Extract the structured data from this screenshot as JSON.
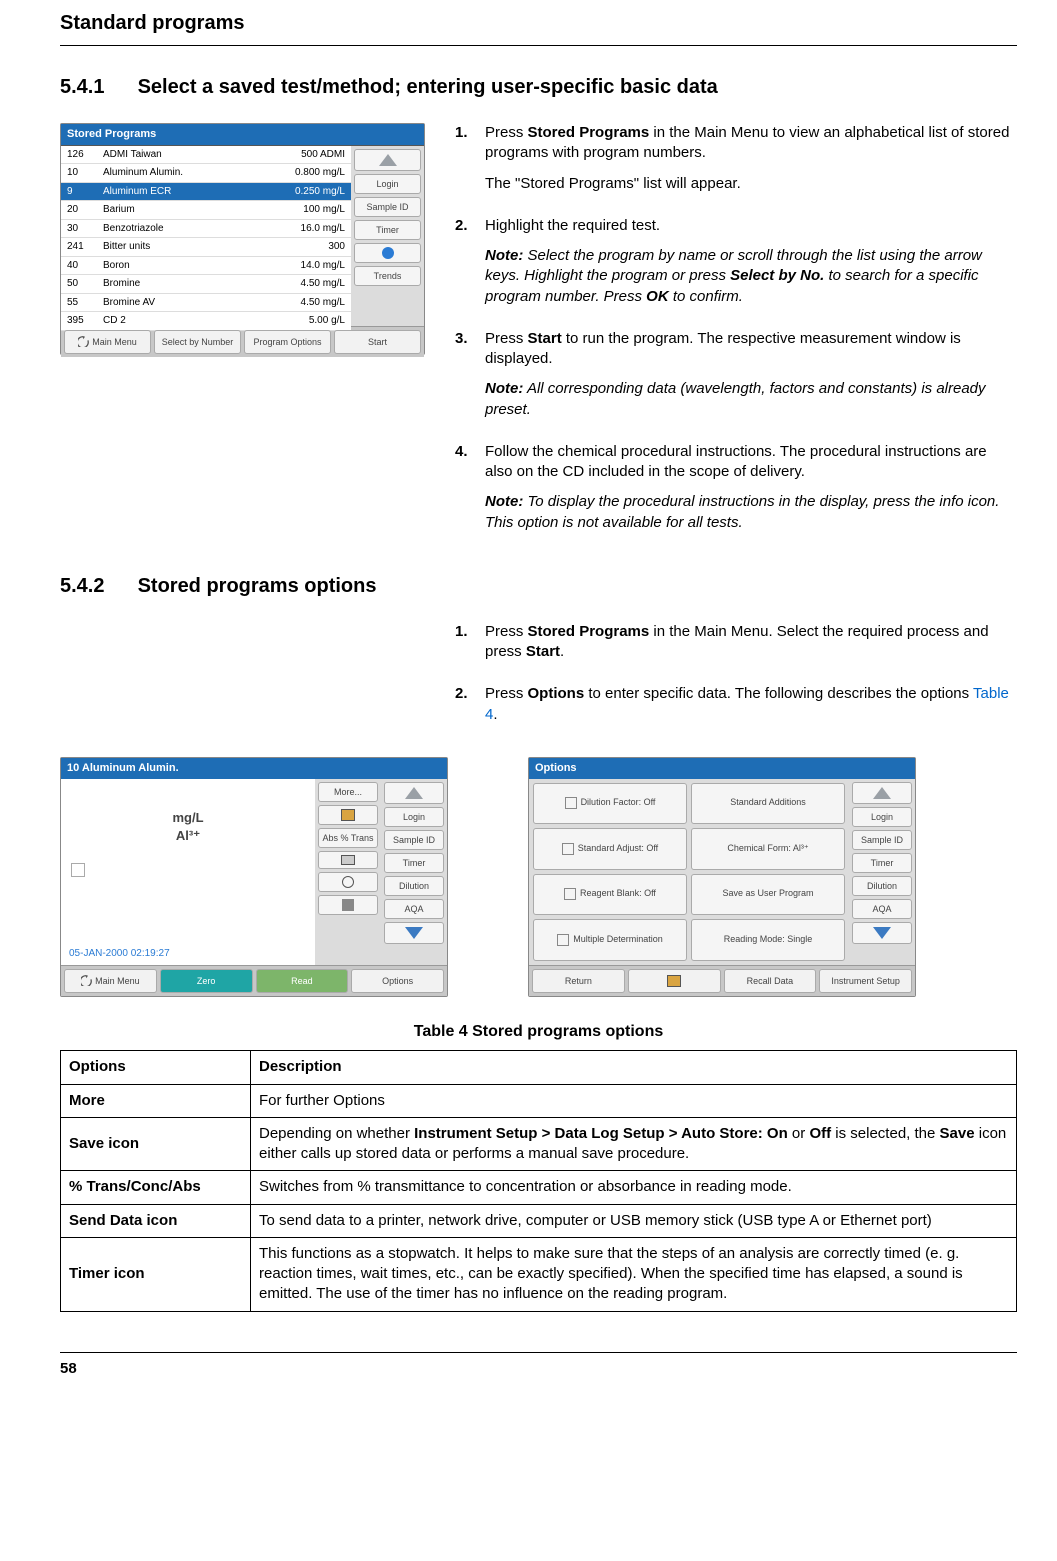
{
  "header": {
    "running": "Standard programs"
  },
  "section_541": {
    "number": "5.4.1",
    "title": "Select a saved test/method; entering user-specific basic data",
    "steps": [
      {
        "num": "1.",
        "paras": [
          "Press <b>Stored Programs</b> in the Main Menu to view an alphabetical list of stored programs with program numbers.",
          "The \"Stored Programs\" list will appear."
        ]
      },
      {
        "num": "2.",
        "paras": [
          "Highlight the required test."
        ],
        "note": "<b>Note:</b> Select the program by name or scroll through the list using the arrow keys. Highlight the program or press <b>Select by No.</b> to search for a specific program number. Press <b>OK</b> to confirm."
      },
      {
        "num": "3.",
        "paras": [
          "Press <b>Start</b> to run the program. The respective measurement window is displayed."
        ],
        "note": "<b>Note:</b> All corresponding data (wavelength, factors and constants) is already preset."
      },
      {
        "num": "4.",
        "paras": [
          "Follow the chemical procedural instructions. The procedural instructions are also on the CD included in the scope of delivery."
        ],
        "note": "<b>Note:</b> To display the procedural instructions in the display, press the info icon. This option is not available for all tests."
      }
    ]
  },
  "section_542": {
    "number": "5.4.2",
    "title": "Stored programs options",
    "steps": [
      {
        "num": "1.",
        "paras": [
          "Press <b>Stored Programs</b> in the Main Menu. Select the required process and press <b>Start</b>."
        ]
      },
      {
        "num": "2.",
        "paras": [
          "Press <b>Options</b> to enter specific data. The following describes the options <span class='link'>Table 4</span>."
        ]
      }
    ]
  },
  "shot1": {
    "title": "Stored Programs",
    "rows": [
      [
        "126",
        "ADMI Taiwan",
        "500 ADMI"
      ],
      [
        "10",
        "Aluminum Alumin.",
        "0.800 mg/L"
      ],
      [
        "9",
        "Aluminum ECR",
        "0.250 mg/L"
      ],
      [
        "20",
        "Barium",
        "100 mg/L"
      ],
      [
        "30",
        "Benzotriazole",
        "16.0 mg/L"
      ],
      [
        "241",
        "Bitter units",
        "300"
      ],
      [
        "40",
        "Boron",
        "14.0 mg/L"
      ],
      [
        "50",
        "Bromine",
        "4.50 mg/L"
      ],
      [
        "55",
        "Bromine AV",
        "4.50 mg/L"
      ],
      [
        "395",
        "CD 2",
        "5.00 g/L"
      ]
    ],
    "selected_index": 2,
    "side": [
      "Login",
      "Sample ID",
      "Timer",
      "",
      "Trends"
    ],
    "bottom": [
      "Main Menu",
      "Select by Number",
      "Program Options",
      "Start"
    ]
  },
  "shot2": {
    "title": "10 Aluminum Alumin.",
    "units": "mg/L",
    "formula": "Al³⁺",
    "timestamp": "05-JAN-2000  02:19:27",
    "opts_col": [
      "More...",
      "",
      "Abs % Trans",
      "",
      "",
      ""
    ],
    "side": [
      "Login",
      "Sample ID",
      "Timer",
      "Dilution",
      "AQA"
    ],
    "bottom": [
      "Main Menu",
      "Zero",
      "Read",
      "Options"
    ]
  },
  "shot3": {
    "title": "Options",
    "grid": [
      "Dilution Factor: Off",
      "Standard Additions",
      "Standard Adjust: Off",
      "Chemical Form: Al³⁺",
      "Reagent Blank: Off",
      "Save as User Program",
      "Multiple Determination",
      "Reading Mode: Single"
    ],
    "side": [
      "Login",
      "Sample ID",
      "Timer",
      "Dilution",
      "AQA"
    ],
    "bottom": [
      "Return",
      "",
      "Recall Data",
      "Instrument Setup"
    ]
  },
  "table4": {
    "caption": "Table 4 Stored programs options",
    "headers": [
      "Options",
      "Description"
    ],
    "rows": [
      [
        "More",
        "For further Options"
      ],
      [
        "Save icon",
        "Depending on whether <b>Instrument Setup > Data Log Setup > Auto Store: On</b> or <b>Off</b> is selected, the <b>Save</b> icon either calls up stored data or performs a manual save procedure."
      ],
      [
        "% Trans/Conc/Abs",
        "Switches from % transmittance to concentration or absorbance in reading mode."
      ],
      [
        "Send Data icon",
        "To send data to a printer, network drive, computer or USB memory stick (USB type A or Ethernet port)"
      ],
      [
        "Timer icon",
        "This functions as a stopwatch. It helps to make sure that the steps of an analysis are correctly timed (e. g. reaction times, wait times, etc., can be exactly specified). When the specified time has elapsed, a sound is emitted. The use of the timer has no influence on the reading program."
      ]
    ]
  },
  "page_number": "58"
}
